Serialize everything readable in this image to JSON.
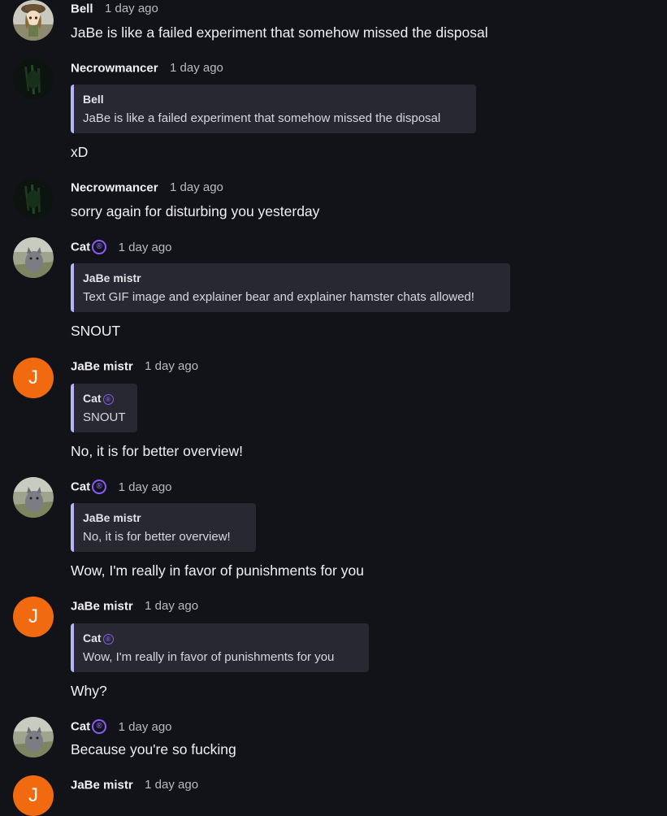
{
  "time_label": "1 day ago",
  "messages": [
    {
      "author": "Bell",
      "badge": "",
      "avatar": "bell-avatar",
      "text": "JaBe is like a failed experiment that somehow missed the disposal"
    },
    {
      "author": "Necrowmancer",
      "badge": "",
      "avatar": "necrowmancer-avatar",
      "quote": {
        "author": "Bell",
        "text": "JaBe is like a failed experiment that somehow missed the disposal"
      },
      "text": "xD"
    },
    {
      "author": "Necrowmancer",
      "badge": "",
      "avatar": "necrowmancer-avatar",
      "text": "sorry again for disturbing you yesterday"
    },
    {
      "author": "Cat",
      "badge": "®",
      "avatar": "cat-avatar",
      "quote": {
        "author": "JaBe mistr",
        "text": "Text GIF image and explainer bear and explainer hamster chats allowed!"
      },
      "text": "SNOUT"
    },
    {
      "author": "JaBe mistr",
      "badge": "",
      "avatar_letter": "J",
      "quote": {
        "author": "Cat",
        "badge": "®",
        "text": "SNOUT"
      },
      "text": "No, it is for better overview!"
    },
    {
      "author": "Cat",
      "badge": "®",
      "avatar": "cat-avatar",
      "quote": {
        "author": "JaBe mistr",
        "text": "No, it is for better overview!"
      },
      "text": "Wow, I'm really in favor of punishments for you"
    },
    {
      "author": "JaBe mistr",
      "badge": "",
      "avatar_letter": "J",
      "quote": {
        "author": "Cat",
        "badge": "®",
        "text": "Wow, I'm really in favor of punishments for you"
      },
      "text": "Why?"
    },
    {
      "author": "Cat",
      "badge": "®",
      "avatar": "cat-avatar",
      "text": "Because you're so fucking"
    },
    {
      "author": "JaBe mistr",
      "badge": "",
      "avatar_letter": "J",
      "text": ""
    }
  ],
  "colors": {
    "background": "#121319",
    "quote_bg": "#272831",
    "quote_border": "#b4b6f6",
    "orange_avatar": "#f26a0f",
    "badge": "#8a5cf6"
  }
}
